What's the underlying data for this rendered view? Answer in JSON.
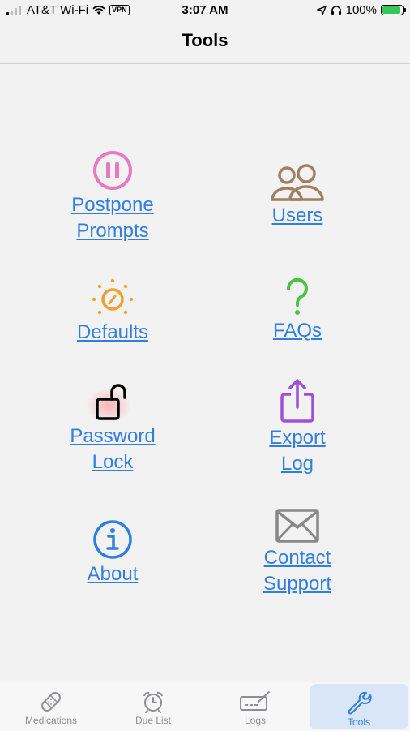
{
  "status_bar": {
    "carrier": "AT&T Wi-Fi",
    "vpn": "VPN",
    "time": "3:07 AM",
    "battery": "100%"
  },
  "header": {
    "title": "Tools"
  },
  "tools": {
    "postpone": {
      "line1": "Postpone",
      "line2": "Prompts",
      "icon": "pause-circle-icon",
      "color": "#e879c0"
    },
    "users": {
      "line1": "Users",
      "icon": "users-icon",
      "color": "#a08060"
    },
    "defaults": {
      "line1": "Defaults",
      "icon": "sun-dial-icon",
      "color": "#f0a030"
    },
    "faqs": {
      "line1": "FAQs",
      "icon": "question-mark-icon",
      "color": "#4cc244"
    },
    "password": {
      "line1": "Password",
      "line2": "Lock",
      "icon": "unlock-icon",
      "color": "#000000"
    },
    "export": {
      "line1": "Export",
      "line2": "Log",
      "icon": "share-icon",
      "color": "#a050d8"
    },
    "about": {
      "line1": "About",
      "icon": "info-circle-icon",
      "color": "#2f7ee0"
    },
    "contact": {
      "line1": "Contact",
      "line2": "Support",
      "icon": "envelope-icon",
      "color": "#888888"
    }
  },
  "tabbar": {
    "tabs": [
      {
        "label": "Medications",
        "icon": "bandage-icon",
        "active": false
      },
      {
        "label": "Due List",
        "icon": "alarm-clock-icon",
        "active": false
      },
      {
        "label": "Logs",
        "icon": "log-book-icon",
        "active": false
      },
      {
        "label": "Tools",
        "icon": "wrench-icon",
        "active": true
      }
    ]
  },
  "colors": {
    "link": "#2f7ee0",
    "active_tab_bg": "#d8e6f7"
  }
}
